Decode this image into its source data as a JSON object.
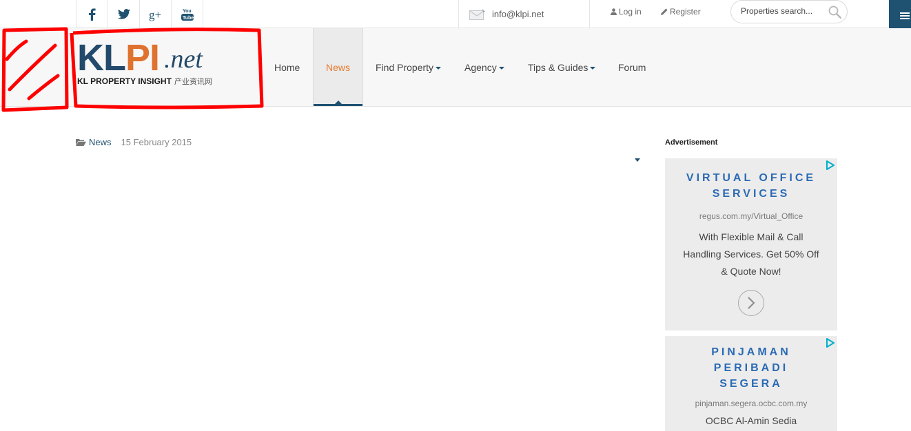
{
  "topbar": {
    "social": [
      {
        "name": "facebook-icon"
      },
      {
        "name": "twitter-icon"
      },
      {
        "name": "google-plus-icon",
        "glyph": "g+"
      },
      {
        "name": "youtube-icon",
        "glyph": "You Tube"
      }
    ],
    "email": "info@klpi.net",
    "login": "Log in",
    "register": "Register",
    "search_placeholder": "Properties search...",
    "menu_icon": "hamburger-icon"
  },
  "logo": {
    "kl": "KL",
    "pi": "PI",
    "net": ".net",
    "tagline": "KL PROPERTY INSIGHT",
    "tagline_cn": "产业资讯网"
  },
  "nav": {
    "items": [
      {
        "label": "Home",
        "has_caret": false
      },
      {
        "label": "News",
        "active": true,
        "has_caret": false
      },
      {
        "label": "Find Property",
        "has_caret": true
      },
      {
        "label": "Agency",
        "has_caret": true
      },
      {
        "label": "Tips & Guides",
        "has_caret": true
      },
      {
        "label": "Forum",
        "has_caret": false
      }
    ]
  },
  "article": {
    "category": "News",
    "date": "15 February 2015"
  },
  "sidebar": {
    "ad_heading": "Advertisement",
    "ads": [
      {
        "headline": "VIRTUAL OFFICE SERVICES",
        "url": "regus.com.my/Virtual_Office",
        "body": "With Flexible Mail & Call Handling Services. Get 50% Off & Quote Now!"
      },
      {
        "headline": "PINJAMAN PERIBADI SEGERA",
        "url": "pinjaman.segera.ocbc.com.my",
        "body": "OCBC Al-Amin Sedia"
      }
    ]
  },
  "colors": {
    "brand_blue": "#1f5170",
    "accent_orange": "#e87a2e",
    "ad_blue": "#2a6ab4",
    "annotation_red": "#ff0000"
  }
}
